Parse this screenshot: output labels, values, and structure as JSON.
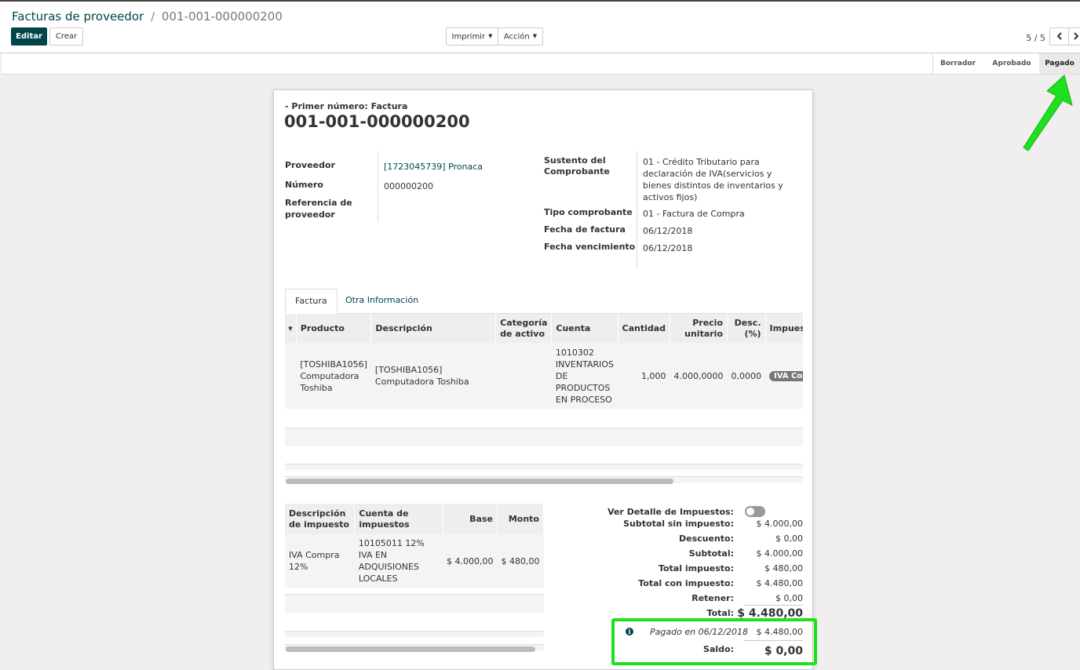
{
  "header": {
    "breadcrumb_parent": "Facturas de proveedor",
    "breadcrumb_separator": "/",
    "breadcrumb_current": "001-001-000000200",
    "edit_label": "Editar",
    "create_label": "Crear",
    "print_label": "Imprimir",
    "action_label": "Acción",
    "pager": "5 / 5"
  },
  "status_stages": [
    {
      "label": "Borrador"
    },
    {
      "label": "Aprobado"
    },
    {
      "label": "Pagado"
    }
  ],
  "form": {
    "subtitle": "- Primer número: Factura",
    "title": "001-001-000000200",
    "left_fields": [
      {
        "label": "Proveedor",
        "value": "[1723045739] Pronaca"
      },
      {
        "label": "Número",
        "value": "000000200"
      },
      {
        "label": "Referencia de proveedor",
        "value": ""
      }
    ],
    "right_fields": [
      {
        "label": "Sustento del Comprobante",
        "value": "01 - Crédito Tributario para declaración de IVA(servicios y bienes distintos de inventarios y activos fijos)"
      },
      {
        "label": "Tipo comprobante",
        "value": "01 - Factura de Compra"
      },
      {
        "label": "Fecha de factura",
        "value": "06/12/2018"
      },
      {
        "label": "Fecha vencimiento",
        "value": "06/12/2018"
      }
    ]
  },
  "tabs": [
    {
      "label": "Factura"
    },
    {
      "label": "Otra Información"
    }
  ],
  "lines_table": {
    "columns": [
      "Producto",
      "Descripción",
      "Categoría de activo",
      "Cuenta",
      "Cantidad",
      "Precio unitario",
      "Desc. (%)",
      "Impuestos"
    ],
    "rows": [
      {
        "product": "[TOSHIBA1056] Computadora Toshiba",
        "description": "[TOSHIBA1056] Computadora Toshiba",
        "category": "",
        "account": "1010302 INVENTARIOS DE PRODUCTOS EN PROCESO",
        "quantity": "1,000",
        "price": "4.000,0000",
        "discount": "0,0000",
        "tax": "IVA Compra"
      }
    ]
  },
  "tax_table": {
    "columns": [
      "Descripción de impuesto",
      "Cuenta de impuestos",
      "Base",
      "Monto"
    ],
    "rows": [
      {
        "description": "IVA Compra 12%",
        "account": "10105011 12% IVA EN ADQUISIONES LOCALES",
        "base": "$ 4.000,00",
        "amount": "$ 480,00"
      }
    ]
  },
  "totals": {
    "toggle_label": "Ver Detalle de Impuestos:",
    "rows": [
      {
        "label": "Subtotal sin impuesto:",
        "value": "$ 4.000,00"
      },
      {
        "label": "Descuento:",
        "value": "$ 0,00"
      },
      {
        "label": "Subtotal:",
        "value": "$ 4.000,00"
      },
      {
        "label": "Total impuesto:",
        "value": "$ 480,00"
      },
      {
        "label": "Total con impuesto:",
        "value": "$ 4.480,00"
      },
      {
        "label": "Retener:",
        "value": "$ 0,00"
      }
    ],
    "total_label": "Total:",
    "total_value": "$ 4.480,00",
    "payment_label": "Pagado en 06/12/2018",
    "payment_value": "$ 4.480,00",
    "balance_label": "Saldo:",
    "balance_value": "$ 0,00"
  },
  "colors": {
    "primary": "#00454a",
    "highlight": "#1fe01f",
    "tax_badge": "#777777"
  },
  "icons": {
    "info": "info-circle-icon",
    "arrow": "green-arrow-annotation",
    "prev": "chevron-left-icon",
    "next": "chevron-right-icon"
  }
}
